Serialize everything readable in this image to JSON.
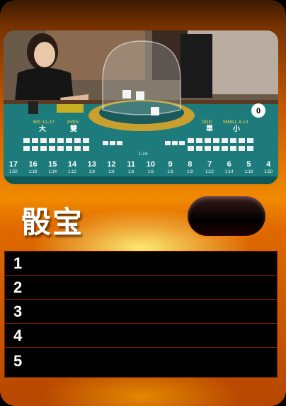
{
  "title": "骰宝",
  "rows": [
    "1",
    "2",
    "3",
    "4",
    "5"
  ],
  "table": {
    "counter": "0",
    "big_label": "BIG 11-17",
    "big_cn": "大",
    "even_label": "EVEN",
    "even_cn": "雙",
    "odd_label": "ODD",
    "odd_cn": "單",
    "small_label": "SMALL 4-10",
    "small_cn": "小",
    "totals": [
      "17",
      "16",
      "15",
      "14",
      "13",
      "12",
      "11",
      "10",
      "9",
      "8",
      "7",
      "6",
      "5",
      "4"
    ],
    "payouts": [
      "1:50",
      "1:18",
      "1:14",
      "1:12",
      "1:8",
      "1:6",
      "1:6",
      "1:6",
      "1:6",
      "1:8",
      "1:12",
      "1:14",
      "1:18",
      "1:50"
    ],
    "any_triple": "1:24"
  },
  "colors": {
    "felt": "#1e7b7b",
    "accent": "#f08a00"
  }
}
